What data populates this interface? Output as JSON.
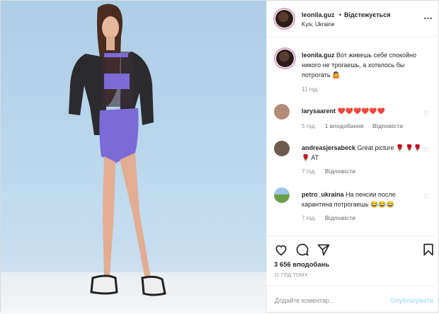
{
  "header": {
    "username": "leonila.guz",
    "dot": "•",
    "follow_label": "Відстежується",
    "location": "Kyiv, Ukraine",
    "more_icon": "…"
  },
  "caption": {
    "username": "leonila.guz",
    "text": "Вот живешь себе спокойно никого не трогаешь, а хотелось бы потрогать 🤷",
    "time": "11 год."
  },
  "comments": [
    {
      "username": "larysaarent",
      "text": "❤️❤️❤️❤️❤️❤️",
      "time": "5 год.",
      "likes": "1 вподобання",
      "reply": "Відповісти"
    },
    {
      "username": "andreasjersabeck",
      "text": "Great picture 🌹 🌹🌹🌹 AT",
      "time": "7 год.",
      "likes": "",
      "reply": "Відповісти"
    },
    {
      "username": "petro_ukraina",
      "text": "На пенсии после карантина потрогаешь 😂😂😂",
      "time": "7 год.",
      "likes": "",
      "reply": "Відповісти"
    }
  ],
  "actions": {
    "likes_count": "3 656 вподобань",
    "posted_time": "11 ГОД ТОМУ"
  },
  "add_comment": {
    "placeholder": "Додайте коментар...",
    "publish_label": "Опублікувати"
  },
  "icons": {
    "like": "heart-icon",
    "comment": "comment-icon",
    "share": "share-icon",
    "save": "bookmark-icon"
  }
}
